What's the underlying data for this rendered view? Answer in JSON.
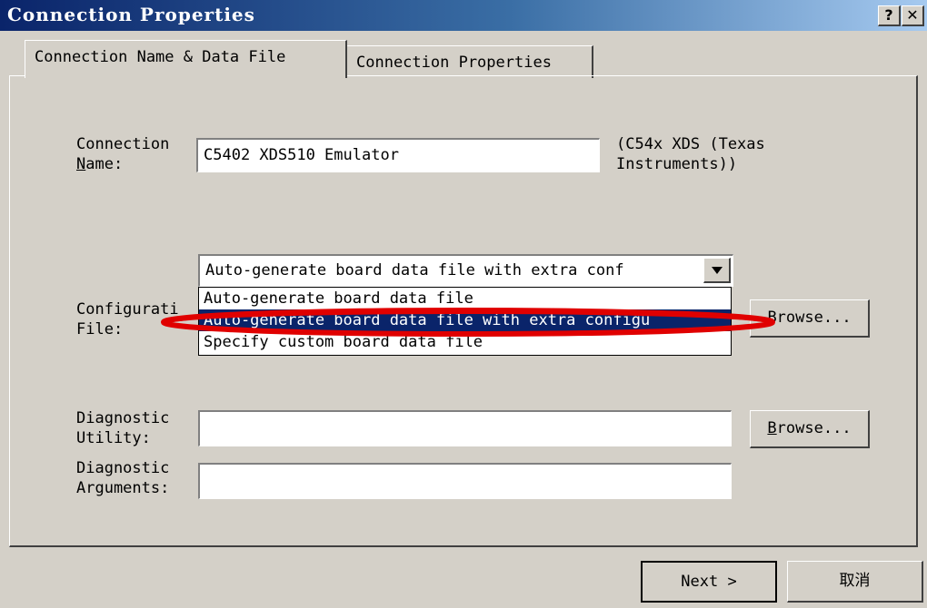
{
  "window": {
    "title": "Connection Properties",
    "help_label": "?",
    "close_label": "✕"
  },
  "tabs": [
    {
      "label": "Connection Name & Data File",
      "active": true
    },
    {
      "label": "Connection Properties",
      "active": false
    }
  ],
  "connection_name": {
    "label_line1": "Connection",
    "label_line2_mnemonic": "N",
    "label_line2_rest": "ame:",
    "value": "C5402 XDS510 Emulator",
    "note_line1": "(C54x XDS (Texas",
    "note_line2": "Instruments))"
  },
  "configuration_file": {
    "label_line1": "Configurati",
    "label_line2": "File:",
    "selected": "Auto-generate board data file with extra conf",
    "options": [
      "Auto-generate board data file",
      "Auto-generate board data file with extra configu",
      "Specify custom board data file"
    ],
    "highlighted_index": 1,
    "browse_label": "Browse..."
  },
  "diagnostic_utility": {
    "label_line1": "Diagnostic",
    "label_line2": "Utility:",
    "value": "",
    "browse_mnemonic": "B",
    "browse_rest": "rowse..."
  },
  "diagnostic_arguments": {
    "label_line1": "Diagnostic",
    "label_line2": "Arguments:",
    "value": ""
  },
  "footer": {
    "next_label": "Next >",
    "cancel_label": "取消"
  },
  "colors": {
    "title_bar": "#0a246a",
    "dialog_bg": "#d4d0c8",
    "highlight": "#0a246a",
    "annotation": "#e00000"
  }
}
